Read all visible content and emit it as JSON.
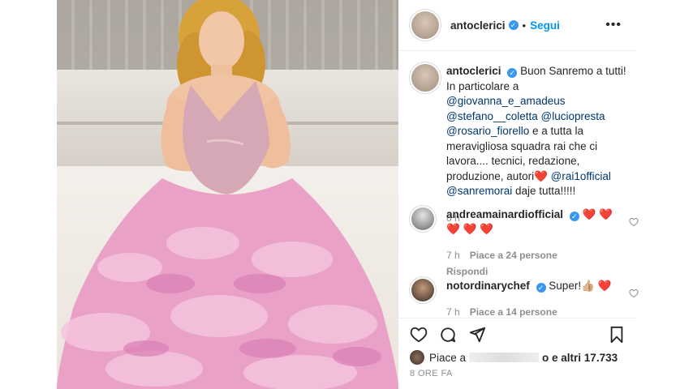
{
  "post": {
    "username": "antoclerici",
    "follow_label": "Segui",
    "more_label": "•••",
    "caption_user": "antoclerici",
    "caption_parts": {
      "a": "Buon Sanremo a tutti! In particolare a ",
      "m1": "@giovanna_e_amadeus",
      "m2": "@stefano__coletta",
      "m3": "@luciopresta",
      "m4": "@rosario_fiorello",
      "b": " e a tutta la meravigliosa squadra rai che ci lavora.... tecnici, redazione, produzione, autori",
      "heart": "❤️",
      "m5": "@rai1official",
      "m6": "@sanremorai",
      "c": " daje tutta!!!!!"
    },
    "caption_time": "8 h"
  },
  "comments": [
    {
      "user": "andreamainardiofficial",
      "text": "❤️ ❤️ ❤️ ❤️ ❤️",
      "time": "7 h",
      "likes": "Piace a 24 persone",
      "reply": "Rispondi"
    },
    {
      "user": "notordinarychef",
      "text": "Super!👍🏼 ❤️",
      "time": "7 h",
      "likes": "Piace a 14 persone"
    }
  ],
  "likes_row": {
    "prefix": "Piace a ",
    "suffix": "o e altri 17.733"
  },
  "posted_ago": "8 ORE FA",
  "icons": [
    "heart-icon",
    "comment-icon",
    "share-icon",
    "bookmark-icon",
    "verified-icon"
  ]
}
